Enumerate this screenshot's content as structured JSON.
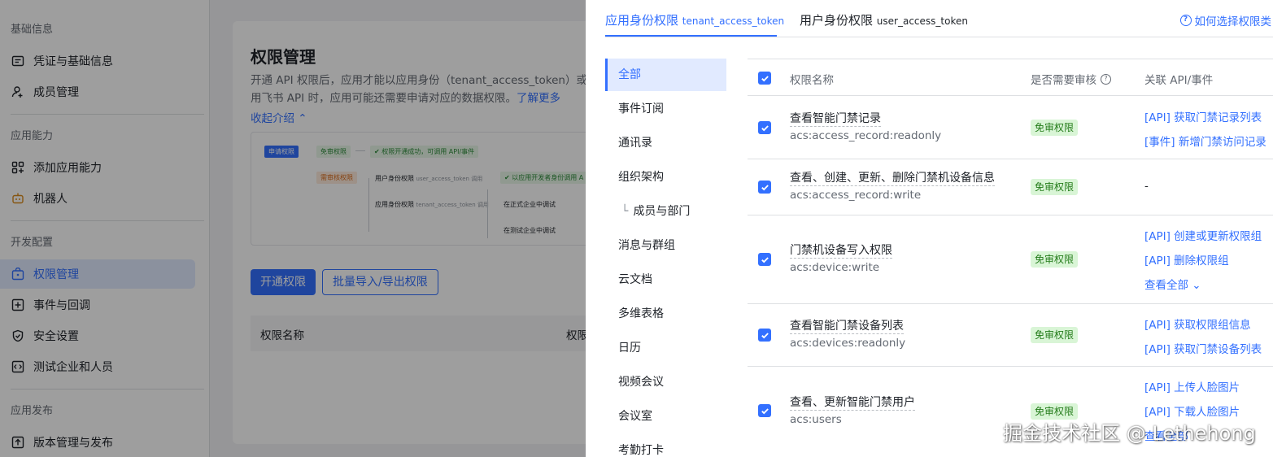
{
  "sidebar": {
    "sections": [
      {
        "title": "基础信息"
      },
      {
        "title": "应用能力"
      },
      {
        "title": "开发配置"
      },
      {
        "title": "应用发布"
      }
    ],
    "items": [
      {
        "label": "凭证与基础信息",
        "icon": "id-card-icon"
      },
      {
        "label": "成员管理",
        "icon": "user-add-icon"
      },
      {
        "label": "添加应用能力",
        "icon": "grid-plus-icon"
      },
      {
        "label": "机器人",
        "icon": "robot-icon"
      },
      {
        "label": "权限管理",
        "icon": "lock-box-icon",
        "active": true
      },
      {
        "label": "事件与回调",
        "icon": "event-icon"
      },
      {
        "label": "安全设置",
        "icon": "shield-icon"
      },
      {
        "label": "测试企业和人员",
        "icon": "code-icon"
      },
      {
        "label": "版本管理与发布",
        "icon": "release-icon"
      }
    ]
  },
  "main": {
    "title": "权限管理",
    "desc_part1": "开通 API 权限后，应用才能以应用身份（tenant_access_token）或",
    "desc_part2": "用飞书 API 时，应用可能还需要申请对应的数据权限。",
    "desc_link": "了解更多",
    "collapse": "收起介绍",
    "flow": {
      "apply": "申请权限",
      "no_review": "免审权限",
      "no_review_result": "权限开通成功，可调用 API/事件",
      "need_review": "需审核权限",
      "user_identity": "用户身份权限",
      "user_token": "user_access_token 调用",
      "user_result": "以应用开发者身份调用 A",
      "app_identity": "应用身份权限",
      "tenant_token": "tenant_access_token 调用",
      "formal": "在正式企业中调试",
      "test": "在测试企业中调试"
    },
    "buttons": {
      "open": "开通权限",
      "batch": "批量导入/导出权限"
    },
    "table_head": {
      "name": "权限名称",
      "perm": "权限"
    }
  },
  "drawer": {
    "tabs": [
      {
        "label": "应用身份权限",
        "token": "tenant_access_token",
        "active": true
      },
      {
        "label": "用户身份权限",
        "token": "user_access_token",
        "active": false
      }
    ],
    "help": "如何选择权限类",
    "categories": [
      {
        "label": "全部",
        "active": true
      },
      {
        "label": "事件订阅"
      },
      {
        "label": "通讯录"
      },
      {
        "label": "组织架构"
      },
      {
        "label": "成员与部门",
        "sub": true
      },
      {
        "label": "消息与群组"
      },
      {
        "label": "云文档"
      },
      {
        "label": "多维表格"
      },
      {
        "label": "日历"
      },
      {
        "label": "视频会议"
      },
      {
        "label": "会议室"
      },
      {
        "label": "考勤打卡"
      }
    ],
    "columns": {
      "name": "权限名称",
      "review": "是否需要审核",
      "api": "关联 API/事件"
    },
    "rows": [
      {
        "name": "查看智能门禁记录",
        "code": "acs:access_record:readonly",
        "badge": "免审权限",
        "apis": [
          "[API] 获取门禁记录列表",
          "[事件] 新增门禁访问记录"
        ]
      },
      {
        "name": "查看、创建、更新、删除门禁机设备信息",
        "code": "acs:access_record:write",
        "badge": "免审权限",
        "apis": [
          "-"
        ]
      },
      {
        "name": "门禁机设备写入权限",
        "code": "acs:device:write",
        "badge": "免审权限",
        "apis": [
          "[API] 创建或更新权限组",
          "[API] 删除权限组"
        ],
        "more": "查看全部"
      },
      {
        "name": "查看智能门禁设备列表",
        "code": "acs:devices:readonly",
        "badge": "免审权限",
        "apis": [
          "[API] 获取权限组信息",
          "[API] 获取门禁设备列表"
        ]
      },
      {
        "name": "查看、更新智能门禁用户",
        "code": "acs:users",
        "badge": "免审权限",
        "apis": [
          "[API] 上传人脸图片",
          "[API] 下载人脸图片"
        ],
        "more": "查看全部"
      }
    ]
  },
  "watermark": "掘金技术社区 @ Lethehong",
  "colors": {
    "accent": "#3370ff",
    "badge_bg": "#d9f5d6",
    "badge_text": "#237b19"
  }
}
